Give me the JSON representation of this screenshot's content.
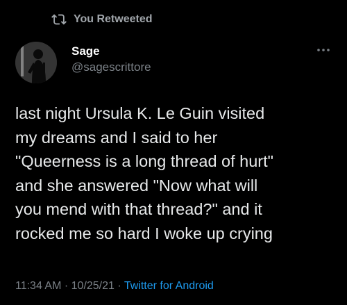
{
  "retweet": {
    "icon": "retweet-icon",
    "label": "You Retweeted"
  },
  "author": {
    "avatar": "avatar-silhouette",
    "name": "Sage",
    "handle": "@sagescrittore"
  },
  "menu": {
    "icon": "more-horizontal-icon"
  },
  "tweet": {
    "lines": [
      "last night Ursula K. Le Guin visited",
      "my dreams and I said to her",
      "\"Queerness is a long thread of hurt\"",
      "and she answered \"Now what will",
      "you mend with that thread?\" and it",
      "rocked me so hard I woke up crying"
    ]
  },
  "meta": {
    "time": "11:34 AM",
    "separator": " · ",
    "date": "10/25/21",
    "source": "Twitter for Android"
  },
  "colors": {
    "background": "#000000",
    "text": "#e7e9ea",
    "muted": "#7b8187",
    "link": "#1d9bf0"
  }
}
